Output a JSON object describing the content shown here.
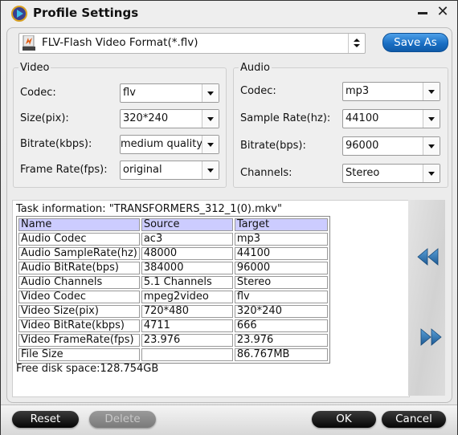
{
  "window": {
    "title": "Profile Settings",
    "minimize_icon": "minimize-icon",
    "close_icon": "close-icon",
    "close_glyph": "✕"
  },
  "format": {
    "icon": "flv-file-icon",
    "selected": "FLV-Flash Video Format(*.flv)",
    "save_as_label": "Save As"
  },
  "video": {
    "legend": "Video",
    "fields": [
      {
        "label": "Codec:",
        "value": "flv"
      },
      {
        "label": "Size(pix):",
        "value": "320*240"
      },
      {
        "label": "Bitrate(kbps):",
        "value": "medium quality"
      },
      {
        "label": "Frame Rate(fps):",
        "value": "original"
      }
    ]
  },
  "audio": {
    "legend": "Audio",
    "fields": [
      {
        "label": "Codec:",
        "value": "mp3"
      },
      {
        "label": "Sample Rate(hz):",
        "value": "44100"
      },
      {
        "label": "Bitrate(bps):",
        "value": "96000"
      },
      {
        "label": "Channels:",
        "value": "Stereo"
      }
    ]
  },
  "task": {
    "info_label": "Task information: \"TRANSFORMERS_312_1(0).mkv\"",
    "columns": [
      "Name",
      "Source",
      "Target"
    ],
    "rows": [
      [
        "Audio Codec",
        "ac3",
        "mp3"
      ],
      [
        "Audio SampleRate(hz)",
        "48000",
        "44100"
      ],
      [
        "Audio BitRate(bps)",
        "384000",
        "96000"
      ],
      [
        "Audio Channels",
        "5.1 Channels",
        "Stereo"
      ],
      [
        "Video Codec",
        "mpeg2video",
        "flv"
      ],
      [
        "Video Size(pix)",
        "720*480",
        "320*240"
      ],
      [
        "Video BitRate(kbps)",
        "4711",
        "666"
      ],
      [
        "Video FrameRate(fps)",
        "23.976",
        "23.976"
      ],
      [
        "File Size",
        "",
        "86.767MB"
      ]
    ],
    "free_disk": "Free disk space:128.754GB"
  },
  "nav": {
    "prev_icon": "rewind-icon",
    "next_icon": "fast-forward-icon"
  },
  "buttons": {
    "reset": "Reset",
    "delete": "Delete",
    "ok": "OK",
    "cancel": "Cancel"
  },
  "colors": {
    "accent_blue": "#1a6fc4",
    "table_header": "#ccccff",
    "nav_arrow": "#2f6fa8"
  }
}
